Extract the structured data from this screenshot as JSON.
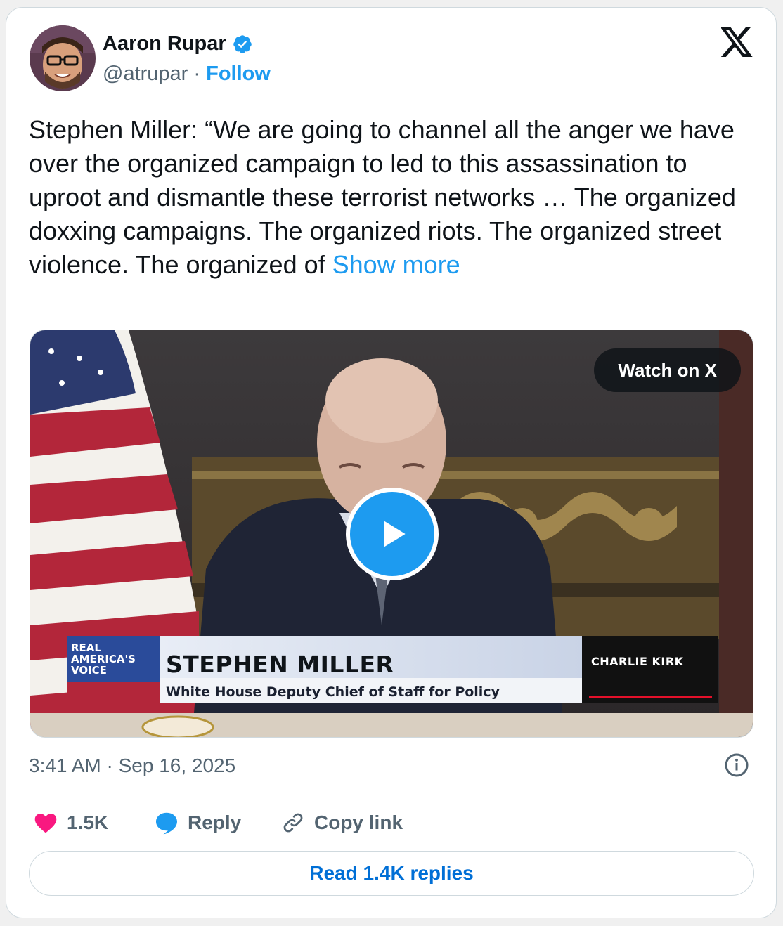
{
  "author": {
    "name": "Aaron Rupar",
    "handle": "@atrupar",
    "separator": "·",
    "follow_label": "Follow",
    "verified_icon": "verified-badge-icon",
    "brand_icon": "x-logo-icon"
  },
  "tweet": {
    "text": "Stephen Miller: “We are going to channel all the anger we have over the organized campaign to led to this assassination to uproot and dismantle these terrorist networks … The organized doxxing campaigns. The organized riots. The organized street violence. The organized of ",
    "show_more": "Show more"
  },
  "media": {
    "watch_label": "Watch on X",
    "lower_third_name": "STEPHEN MILLER",
    "lower_third_title": "White House Deputy Chief of Staff for Policy",
    "network_logo": "REAL AMERICA'S VOICE",
    "show_logo": "CHARLIE KIRK"
  },
  "meta": {
    "timestamp": "3:41 AM · Sep 16, 2025"
  },
  "actions": {
    "likes": "1.5K",
    "reply_label": "Reply",
    "copy_label": "Copy link",
    "read_replies": "Read 1.4K replies"
  },
  "colors": {
    "accent": "#1d9bf0",
    "like": "#f91880",
    "text": "#0f1419",
    "muted": "#536471"
  }
}
